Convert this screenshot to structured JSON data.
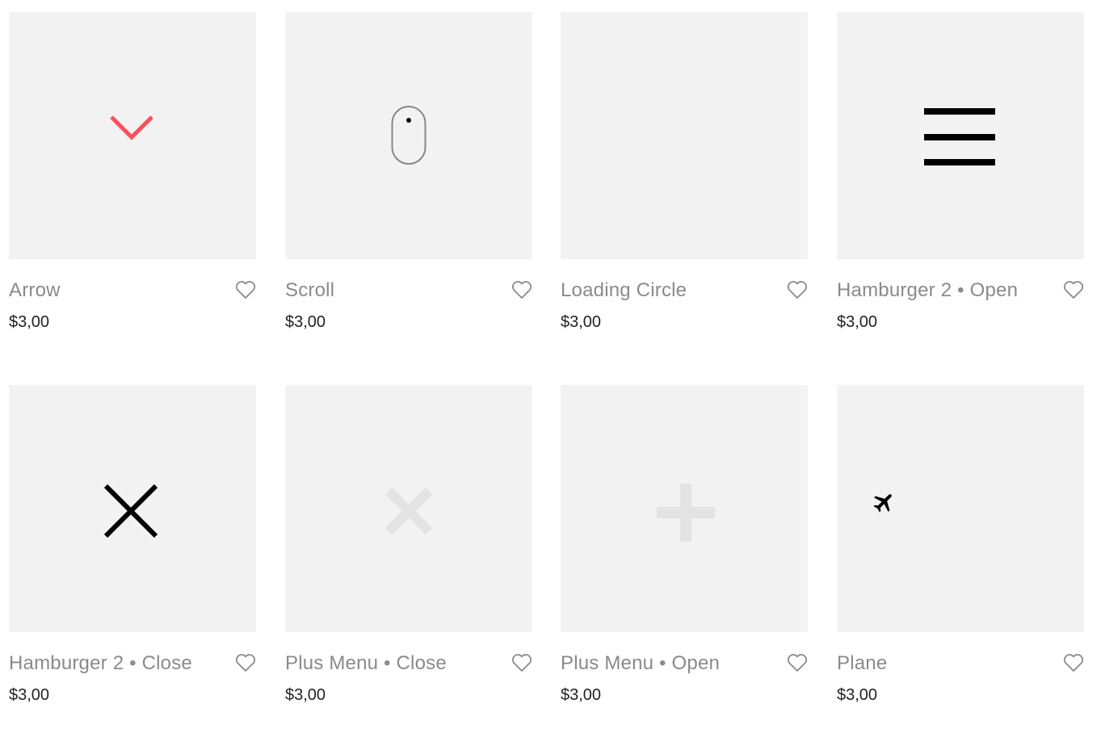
{
  "products": [
    {
      "title": "Arrow",
      "price": "$3,00",
      "icon": "chevron-down-icon",
      "icon_color": "#ff4c57"
    },
    {
      "title": "Scroll",
      "price": "$3,00",
      "icon": "mouse-scroll-icon",
      "icon_color": "#888888"
    },
    {
      "title": "Loading Circle",
      "price": "$3,00",
      "icon": "none",
      "icon_color": "#f2f2f2"
    },
    {
      "title": "Hamburger 2 • Open",
      "price": "$3,00",
      "icon": "hamburger-icon",
      "icon_color": "#000000"
    },
    {
      "title": "Hamburger 2 • Close",
      "price": "$3,00",
      "icon": "close-icon",
      "icon_color": "#000000"
    },
    {
      "title": "Plus Menu • Close",
      "price": "$3,00",
      "icon": "close-icon",
      "icon_color": "#e3e3e3"
    },
    {
      "title": "Plus Menu • Open",
      "price": "$3,00",
      "icon": "plus-icon",
      "icon_color": "#e3e3e3"
    },
    {
      "title": "Plane",
      "price": "$3,00",
      "icon": "plane-icon",
      "icon_color": "#000000"
    }
  ],
  "favorite_icon": "heart-outline-icon",
  "colors": {
    "thumb_background": "#f2f2f2",
    "title_text": "#8a8a8a",
    "price_text": "#222222",
    "heart_stroke": "#8a8a8a"
  }
}
